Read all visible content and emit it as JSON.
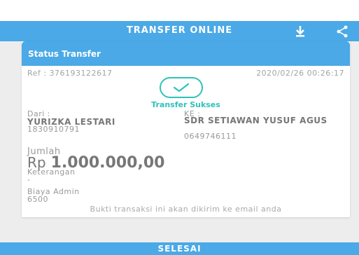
{
  "header": {
    "title": "TRANSFER ONLINE",
    "icons": [
      "download-icon",
      "share-icon"
    ]
  },
  "card": {
    "title": "Status Transfer",
    "ref": "Ref : 376193122617",
    "datetime": "2020/02/26 00:26:17",
    "status": "Transfer Sukses",
    "from": {
      "label": "Dari :",
      "name": "YURIZKA LESTARI",
      "account": "1830910791"
    },
    "to": {
      "label": "KE :",
      "name": "SDR SETIAWAN YUSUF AGUS",
      "account": "0649746111"
    },
    "amount": {
      "label": "Jumlah",
      "currency": "Rp",
      "value": "1.000.000,00"
    },
    "note": {
      "label": "Keterangan",
      "value": "-"
    },
    "admin_fee": {
      "label": "Biaya Admin",
      "value": "6500"
    },
    "footnote": "Bukti transaksi ini akan dikirim ke email anda"
  },
  "footer": {
    "button_label": "SELESAI"
  },
  "colors": {
    "accent": "#4aa9e6",
    "success": "#2fc2b8"
  }
}
